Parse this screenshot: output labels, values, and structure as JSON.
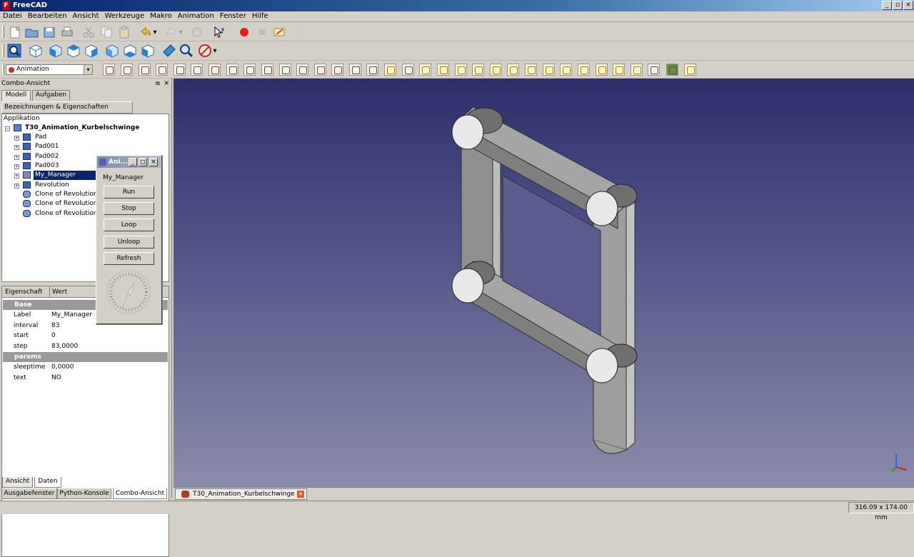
{
  "window": {
    "title": "FreeCAD"
  },
  "menu": [
    "Datei",
    "Bearbeiten",
    "Ansicht",
    "Werkzeuge",
    "Makro",
    "Animation",
    "Fenster",
    "Hilfe"
  ],
  "workbench_select": "Animation",
  "combo": {
    "title": "Combo-Ansicht",
    "tabs": [
      "Modell",
      "Aufgaben"
    ],
    "tree_header": "Bezeichnungen & Eigenschaften",
    "tree_root": "Applikation",
    "doc_name": "T30_Animation_Kurbelschwinge",
    "items": [
      "Pad",
      "Pad001",
      "Pad002",
      "Pad003",
      "My_Manager",
      "Revolution",
      "Clone of Revolution",
      "Clone of Revolution0",
      "Clone of Revolution0"
    ]
  },
  "properties": {
    "col_prop": "Eigenschaft",
    "col_value": "Wert",
    "groups": [
      {
        "name": "Base",
        "rows": [
          [
            "Label",
            "My_Manager"
          ],
          [
            "interval",
            "83"
          ],
          [
            "start",
            "0"
          ],
          [
            "step",
            "83,0000"
          ]
        ]
      },
      {
        "name": "params",
        "rows": [
          [
            "sleeptime",
            "0,0000"
          ],
          [
            "text",
            "NO"
          ]
        ]
      }
    ],
    "bottom_tabs": [
      "Ansicht",
      "Daten"
    ]
  },
  "dialog": {
    "title": "Ani...",
    "label": "My_Manager",
    "buttons": [
      "Run",
      "Stop",
      "Loop",
      "Unloop",
      "Refresh"
    ]
  },
  "dock_tabs": [
    "Ausgabefenster",
    "Python-Konsole",
    "Combo-Ansicht"
  ],
  "document_tab": "T30_Animation_Kurbelschwinge : 1*",
  "status": {
    "dimensions": "316.09 x 174.00 mm"
  },
  "colors": {
    "viewport_top": "#2e2f6b",
    "viewport_bottom": "#8b8cab",
    "selection": "#0a246a",
    "part": "#9c9c9c"
  },
  "icons": [
    "new-icon",
    "open-icon",
    "save-icon",
    "print-icon",
    "cut-icon",
    "copy-icon",
    "paste-icon",
    "undo-icon",
    "redo-icon",
    "refresh-icon",
    "whats-this-icon",
    "record-macro-icon",
    "stop-macro-icon",
    "edit-macro-icon",
    "run-macro-icon",
    "fit-all-icon",
    "axo-view-icon",
    "front-view-icon",
    "top-view-icon",
    "right-view-icon",
    "rear-view-icon",
    "bottom-view-icon",
    "left-view-icon",
    "measure-distance-icon",
    "zoom-icon",
    "no-draw-style-icon"
  ]
}
